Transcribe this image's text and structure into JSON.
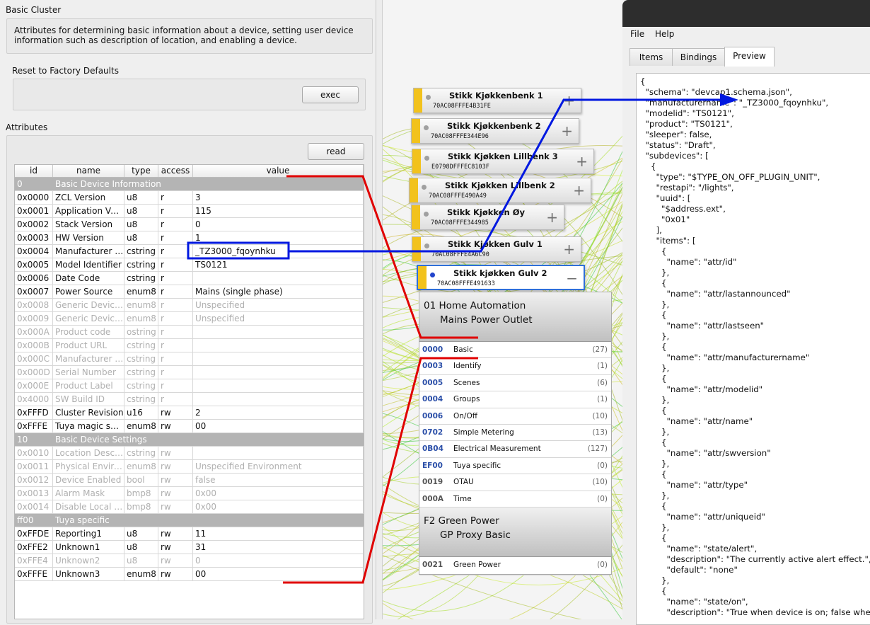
{
  "basic_cluster": {
    "title": "Basic Cluster",
    "description": "Attributes for determining basic information about a device, setting user device information such as description of location, and enabling a device.",
    "reset_label": "Reset to Factory Defaults",
    "exec_label": "exec",
    "attributes_label": "Attributes",
    "read_label": "read",
    "columns": [
      "id",
      "name",
      "type",
      "access",
      "value"
    ],
    "rows": [
      {
        "group": true,
        "id": "0",
        "name": "Basic Device Information"
      },
      {
        "id": "0x0000",
        "name": "ZCL Version",
        "type": "u8",
        "access": "r",
        "value": "3"
      },
      {
        "id": "0x0001",
        "name": "Application Version",
        "type": "u8",
        "access": "r",
        "value": "115"
      },
      {
        "id": "0x0002",
        "name": "Stack Version",
        "type": "u8",
        "access": "r",
        "value": "0"
      },
      {
        "id": "0x0003",
        "name": "HW Version",
        "type": "u8",
        "access": "r",
        "value": "1"
      },
      {
        "id": "0x0004",
        "name": "Manufacturer Name",
        "type": "cstring",
        "access": "r",
        "value": "_TZ3000_fqoynhku"
      },
      {
        "id": "0x0005",
        "name": "Model Identifier",
        "type": "cstring",
        "access": "r",
        "value": "TS0121"
      },
      {
        "id": "0x0006",
        "name": "Date Code",
        "type": "cstring",
        "access": "r",
        "value": ""
      },
      {
        "id": "0x0007",
        "name": "Power Source",
        "type": "enum8",
        "access": "r",
        "value": "Mains (single phase)"
      },
      {
        "dim": true,
        "id": "0x0008",
        "name": "Generic Device Class",
        "type": "enum8",
        "access": "r",
        "value": "Unspecified"
      },
      {
        "dim": true,
        "id": "0x0009",
        "name": "Generic Device Type",
        "type": "enum8",
        "access": "r",
        "value": "Unspecified"
      },
      {
        "dim": true,
        "id": "0x000A",
        "name": "Product code",
        "type": "ostring",
        "access": "r",
        "value": ""
      },
      {
        "dim": true,
        "id": "0x000B",
        "name": "Product URL",
        "type": "cstring",
        "access": "r",
        "value": ""
      },
      {
        "dim": true,
        "id": "0x000C",
        "name": "Manufacturer Version Details",
        "type": "cstring",
        "access": "r",
        "value": ""
      },
      {
        "dim": true,
        "id": "0x000D",
        "name": "Serial Number",
        "type": "cstring",
        "access": "r",
        "value": ""
      },
      {
        "dim": true,
        "id": "0x000E",
        "name": "Product Label",
        "type": "cstring",
        "access": "r",
        "value": ""
      },
      {
        "dim": true,
        "id": "0x4000",
        "name": "SW Build ID",
        "type": "cstring",
        "access": "r",
        "value": ""
      },
      {
        "id": "0xFFFD",
        "name": "Cluster Revision",
        "type": "u16",
        "access": "rw",
        "value": "2"
      },
      {
        "id": "0xFFFE",
        "name": "Tuya magic spell",
        "type": "enum8",
        "access": "rw",
        "value": "00"
      },
      {
        "group": true,
        "id": "10",
        "name": "Basic Device Settings"
      },
      {
        "dim": true,
        "id": "0x0010",
        "name": "Location Description",
        "type": "cstring",
        "access": "rw",
        "value": ""
      },
      {
        "dim": true,
        "id": "0x0011",
        "name": "Physical Environment",
        "type": "enum8",
        "access": "rw",
        "value": "Unspecified Environment"
      },
      {
        "dim": true,
        "id": "0x0012",
        "name": "Device Enabled",
        "type": "bool",
        "access": "rw",
        "value": "false"
      },
      {
        "dim": true,
        "id": "0x0013",
        "name": "Alarm Mask",
        "type": "bmp8",
        "access": "rw",
        "value": "0x00"
      },
      {
        "dim": true,
        "id": "0x0014",
        "name": "Disable Local Config",
        "type": "bmp8",
        "access": "rw",
        "value": "0x00"
      },
      {
        "group": true,
        "id": "ff00",
        "name": "Tuya specific"
      },
      {
        "id": "0xFFDE",
        "name": "Reporting1",
        "type": "u8",
        "access": "rw",
        "value": "11"
      },
      {
        "id": "0xFFE2",
        "name": "Unknown1",
        "type": "u8",
        "access": "rw",
        "value": "31"
      },
      {
        "dim": true,
        "id": "0xFFE4",
        "name": "Unknown2",
        "type": "u8",
        "access": "rw",
        "value": "0"
      },
      {
        "id": "0xFFFE",
        "name": "Unknown3",
        "type": "enum8",
        "access": "rw",
        "value": "00"
      }
    ]
  },
  "graph": {
    "nodes": [
      {
        "name": "Stikk Kjøkkenbenk 1",
        "mac": "70AC08FFFE4B31FE",
        "sign": "+"
      },
      {
        "name": "Stikk Kjøkkenbenk 2",
        "mac": "70AC08FFFE344E96",
        "sign": "+"
      },
      {
        "name": "Stikk Kjøkken Lillbenk 3",
        "mac": "E0798DFFFEC8103F",
        "sign": "+"
      },
      {
        "name": "Stikk Kjøkken Lillbenk 2",
        "mac": "70AC08FFFE490A49",
        "sign": "+"
      },
      {
        "name": "Stikk Kjøkken Øy",
        "mac": "70AC08FFFE344985",
        "sign": "+"
      },
      {
        "name": "Stikk Kjøkken Gulv 1",
        "mac": "70AC08FFFE4A6C90",
        "sign": "+"
      },
      {
        "name": "Stikk kjøkken Gulv 2",
        "mac": "70AC08FFFE491633",
        "sign": "−"
      }
    ],
    "endpoints": [
      {
        "line1": "01  Home Automation",
        "line2": "Mains Power Outlet",
        "clusters": [
          {
            "id": "0000",
            "name": "Basic",
            "count": "(27)"
          },
          {
            "id": "0003",
            "name": "Identify",
            "count": "(1)"
          },
          {
            "id": "0005",
            "name": "Scenes",
            "count": "(6)"
          },
          {
            "id": "0004",
            "name": "Groups",
            "count": "(1)"
          },
          {
            "id": "0006",
            "name": "On/Off",
            "count": "(10)"
          },
          {
            "id": "0702",
            "name": "Simple Metering",
            "count": "(13)"
          },
          {
            "id": "0B04",
            "name": "Electrical Measurement",
            "count": "(127)"
          },
          {
            "id": "EF00",
            "name": "Tuya specific",
            "count": "(0)"
          },
          {
            "id": "0019",
            "name": "OTAU",
            "count": "(10)"
          },
          {
            "id": "000A",
            "name": "Time",
            "count": "(0)"
          }
        ]
      },
      {
        "line1": "F2  Green Power",
        "line2": "GP Proxy Basic",
        "clusters": [
          {
            "id": "0021",
            "name": "Green Power",
            "count": "(0)"
          }
        ]
      }
    ]
  },
  "preview": {
    "menu": [
      "File",
      "Help"
    ],
    "tabs": [
      "Items",
      "Bindings",
      "Preview"
    ],
    "active_tab": "Preview",
    "json_lines": [
      "{",
      "  \"schema\": \"devcap1.schema.json\",",
      "  \"manufacturername\": \"_TZ3000_fqoynhku\",",
      "  \"modelid\": \"TS0121\",",
      "  \"product\": \"TS0121\",",
      "  \"sleeper\": false,",
      "  \"status\": \"Draft\",",
      "  \"subdevices\": [",
      "    {",
      "      \"type\": \"$TYPE_ON_OFF_PLUGIN_UNIT\",",
      "      \"restapi\": \"/lights\",",
      "      \"uuid\": [",
      "        \"$address.ext\",",
      "        \"0x01\"",
      "      ],",
      "      \"items\": [",
      "        {",
      "          \"name\": \"attr/id\"",
      "        },",
      "        {",
      "          \"name\": \"attr/lastannounced\"",
      "        },",
      "        {",
      "          \"name\": \"attr/lastseen\"",
      "        },",
      "        {",
      "          \"name\": \"attr/manufacturername\"",
      "        },",
      "        {",
      "          \"name\": \"attr/modelid\"",
      "        },",
      "        {",
      "          \"name\": \"attr/name\"",
      "        },",
      "        {",
      "          \"name\": \"attr/swversion\"",
      "        },",
      "        {",
      "          \"name\": \"attr/type\"",
      "        },",
      "        {",
      "          \"name\": \"attr/uniqueid\"",
      "        },",
      "        {",
      "          \"name\": \"state/alert\",",
      "          \"description\": \"The currently active alert effect.\",",
      "          \"default\": \"none\"",
      "        },",
      "        {",
      "          \"name\": \"state/on\",",
      "          \"description\": \"True when device is on; false when off.\","
    ]
  },
  "colors": {
    "red": "#e00000",
    "blue": "#0018e0",
    "accent_yellow": "#f2c21c"
  }
}
